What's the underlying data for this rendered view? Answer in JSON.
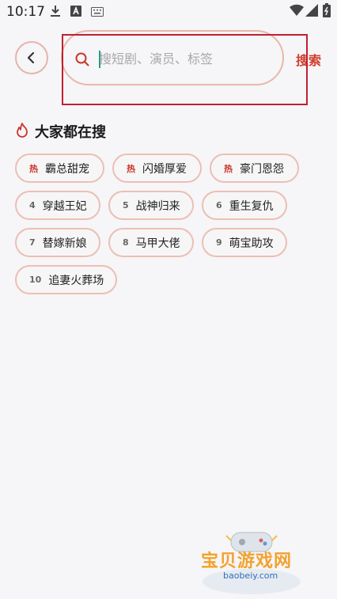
{
  "status_bar": {
    "time": "10:17",
    "icons": [
      "download-icon",
      "a-badge-icon",
      "keyboard-icon",
      "wifi-icon",
      "signal-icon",
      "battery-icon"
    ]
  },
  "search": {
    "placeholder": "搜短剧、演员、标签",
    "button_label": "搜索"
  },
  "hot": {
    "title": "大家都在搜",
    "items": [
      {
        "rank": "热",
        "label": "霸总甜宠",
        "hot": true
      },
      {
        "rank": "热",
        "label": "闪婚厚爱",
        "hot": true
      },
      {
        "rank": "热",
        "label": "豪门恩怨",
        "hot": true
      },
      {
        "rank": "4",
        "label": "穿越王妃",
        "hot": false
      },
      {
        "rank": "5",
        "label": "战神归来",
        "hot": false
      },
      {
        "rank": "6",
        "label": "重生复仇",
        "hot": false
      },
      {
        "rank": "7",
        "label": "替嫁新娘",
        "hot": false
      },
      {
        "rank": "8",
        "label": "马甲大佬",
        "hot": false
      },
      {
        "rank": "9",
        "label": "萌宝助攻",
        "hot": false
      },
      {
        "rank": "10",
        "label": "追妻火葬场",
        "hot": false
      }
    ]
  },
  "watermark": {
    "title": "宝贝游戏网",
    "url": "baobeiy.com"
  },
  "colors": {
    "accent": "#d03d2c",
    "tag_border": "#ebbfb5",
    "background": "#f6f5f7"
  }
}
